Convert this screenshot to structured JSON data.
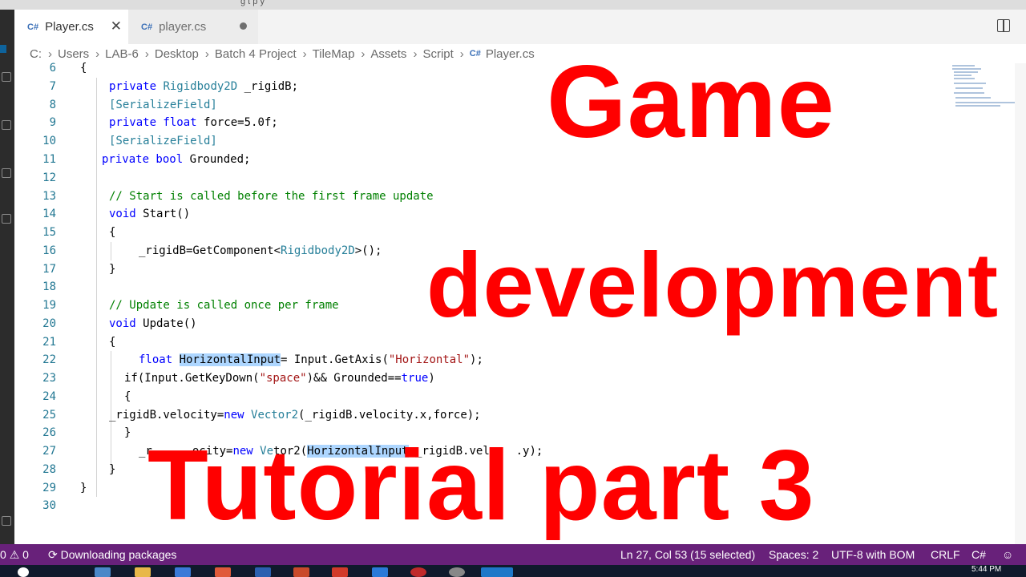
{
  "window": {
    "title_fragment": "g  t  p  y"
  },
  "tabs": [
    {
      "label": "Player.cs",
      "active": true
    },
    {
      "label": "player.cs",
      "active": false,
      "modified": true
    }
  ],
  "breadcrumb": [
    "C:",
    "Users",
    "LAB-6",
    "Desktop",
    "Batch 4 Project",
    "TileMap",
    "Assets",
    "Script"
  ],
  "breadcrumb_file": "Player.cs",
  "file_icon_glyph": "C#",
  "editor": {
    "line_numbers": [
      "6",
      "7",
      "8",
      "9",
      "10",
      "11",
      "12",
      "13",
      "14",
      "15",
      "16",
      "17",
      "18",
      "19",
      "20",
      "21",
      "22",
      "23",
      "24",
      "25",
      "26",
      "27",
      "28",
      "29",
      "30"
    ],
    "lines": {
      "l6_brace": "{",
      "l7_kw": "private ",
      "l7_type": "Rigidbody2D",
      "l7_rest": " _rigidB;",
      "l8_attr": "[SerializeField]",
      "l9_kw": "private float ",
      "l9_rest": "force=5.0f;",
      "l10_attr": "[SerializeField]",
      "l11_kw": "private bool ",
      "l11_rest": "Grounded;",
      "l13_comment": "// Start is called before the first frame update",
      "l14_kw": "void ",
      "l14_rest": "Start()",
      "l15_brace": "{",
      "l16_a": "_rigidB=GetComponent<",
      "l16_type": "Rigidbody2D",
      "l16_b": ">();",
      "l17_brace": "}",
      "l19_comment": "// Update is called once per frame",
      "l20_kw": "void ",
      "l20_rest": "Update()",
      "l21_brace": "{",
      "l22_kw": "float ",
      "l22_sel": "HorizontalInput",
      "l22_a": "= Input.GetAxis(",
      "l22_str": "\"Horizontal\"",
      "l22_b": ");",
      "l23_a": "if(Input.GetKeyDown(",
      "l23_str": "\"space\"",
      "l23_b": ")&& Grounded==",
      "l23_kw": "true",
      "l23_c": ")",
      "l24_brace": "{",
      "l25_a": "_rigidB.velocity=",
      "l25_kw": "new ",
      "l25_type": "Vector2",
      "l25_b": "(_rigidB.velocity.x,force);",
      "l26_brace": "}",
      "l27_a": "_r",
      "l27_b": "ocity=",
      "l27_kw": "new ",
      "l27_type": "Ve",
      "l27_c": "tor2(",
      "l27_sel": "HorizontalInput",
      "l27_d": ",_rigidB.veloc",
      "l27_e": ".y);",
      "l28_brace": "}",
      "l29_brace": "}"
    }
  },
  "overlay": {
    "line1": "Game",
    "line2": "development",
    "line3": "Tutorial part 3",
    "color": "#ff0000"
  },
  "statusbar": {
    "errors": "0",
    "warnings": "0",
    "task": "Downloading packages",
    "position": "Ln 27, Col 53 (15 selected)",
    "spaces": "Spaces: 2",
    "encoding": "UTF-8 with BOM",
    "eol": "CRLF",
    "language": "C#",
    "bg_color": "#68217a"
  },
  "taskbar": {
    "time": "5:44 PM"
  },
  "icons": [
    "csharp-file-icon",
    "close-icon",
    "modified-dot-icon",
    "split-editor-icon",
    "error-icon",
    "warning-icon",
    "sync-icon",
    "feedback-smiley-icon"
  ]
}
